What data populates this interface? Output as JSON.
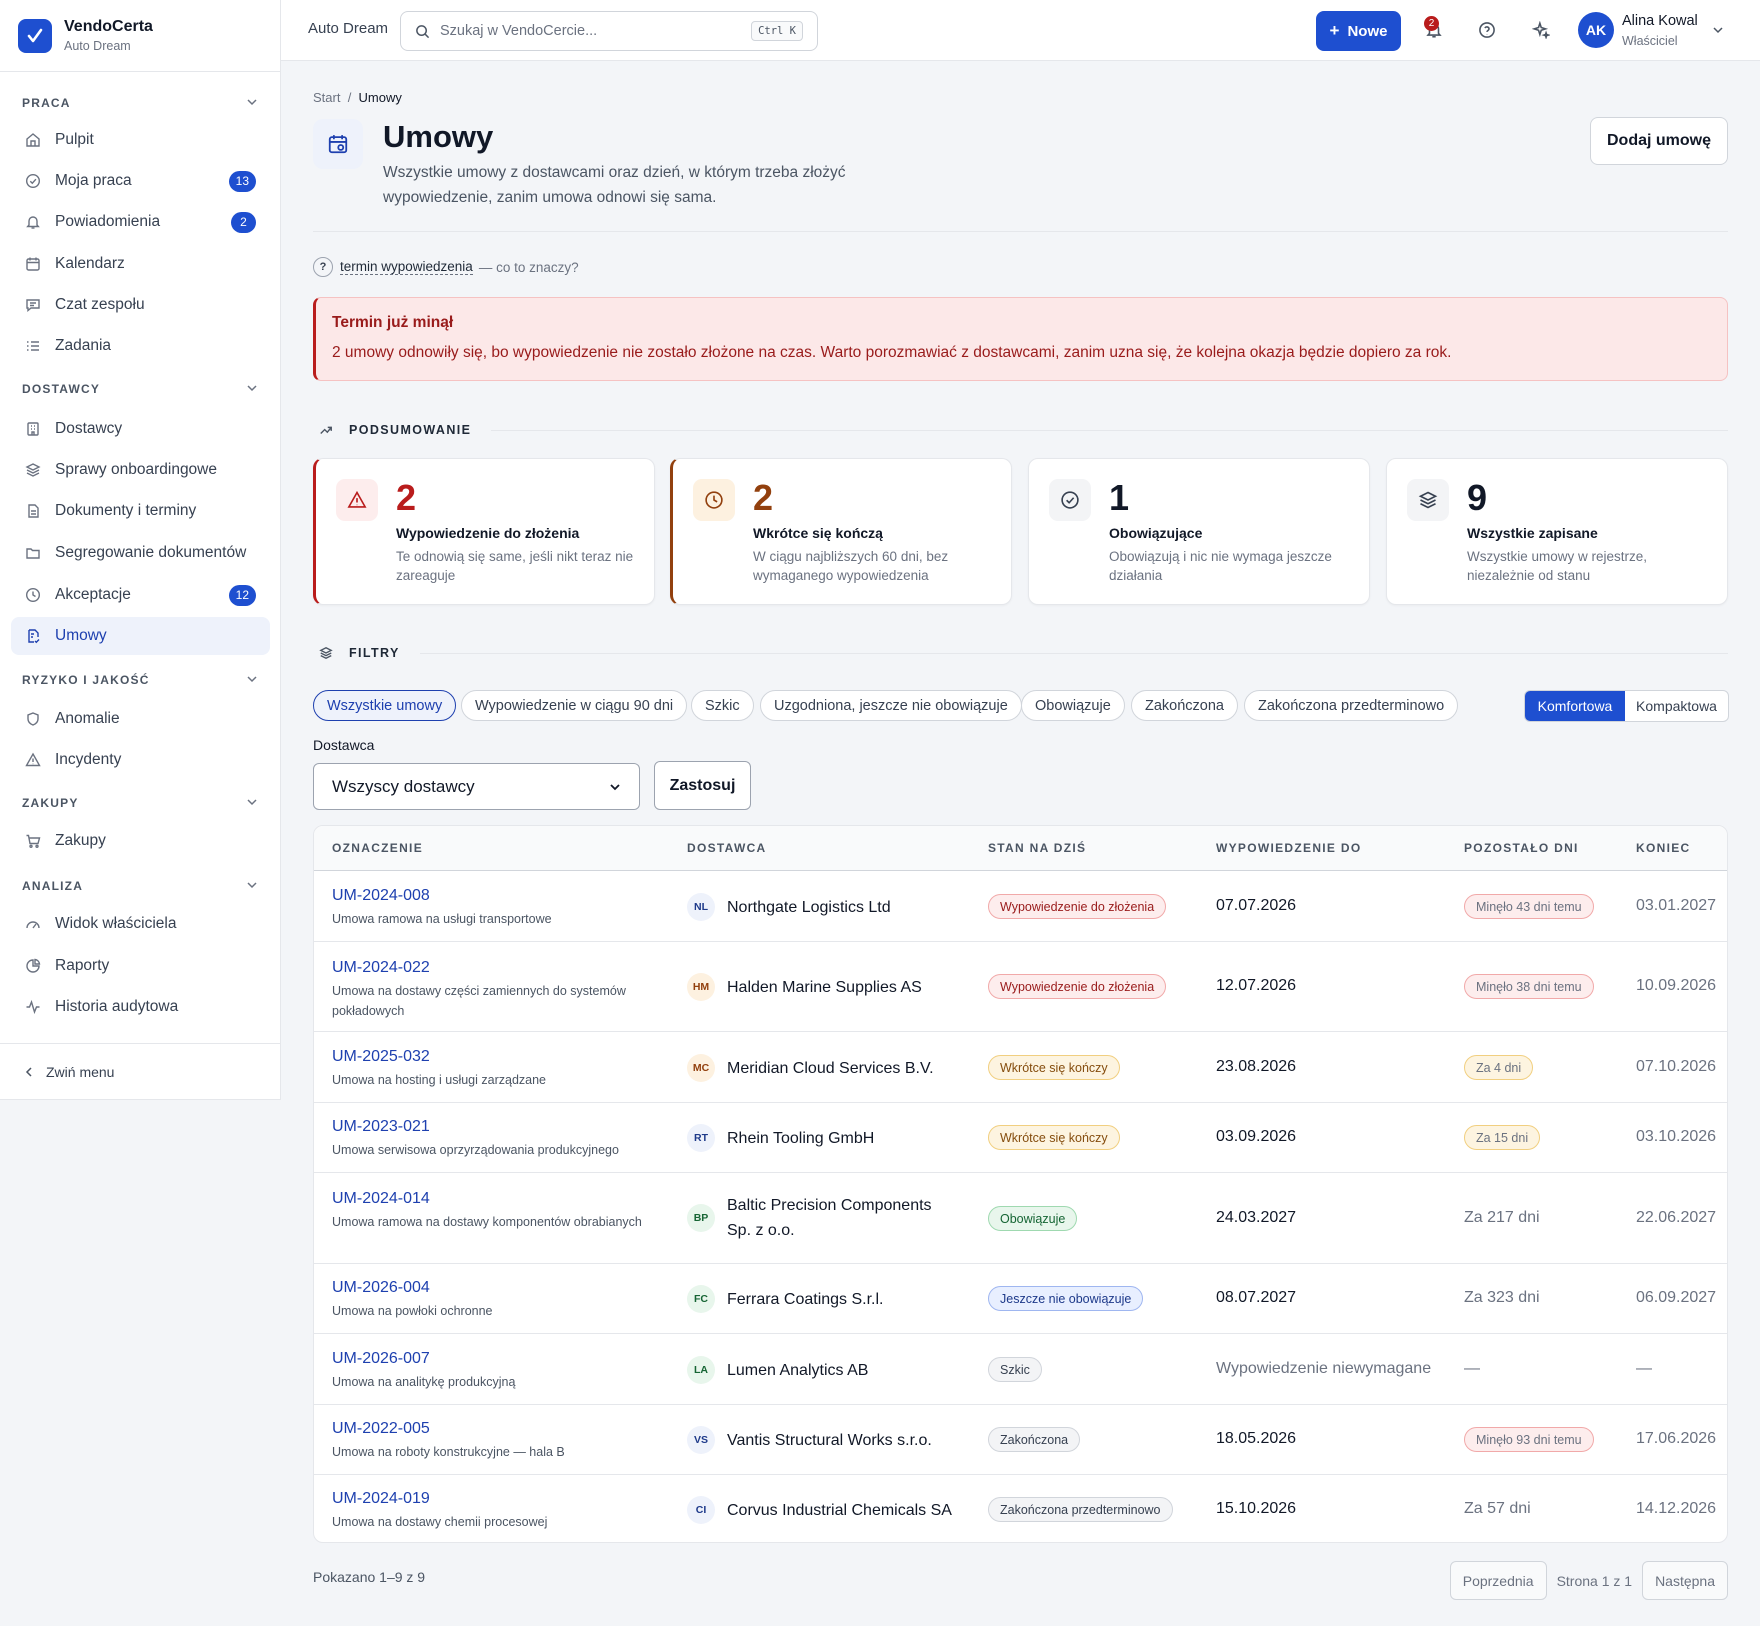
{
  "brand": {
    "name": "VendoCerta",
    "sub": "Auto Dream"
  },
  "sidebar": {
    "sections": [
      {
        "label": "PRACA"
      },
      {
        "label": "DOSTAWCY"
      },
      {
        "label": "RYZYKO I JAKOŚĆ"
      },
      {
        "label": "ZAKUPY"
      },
      {
        "label": "ANALIZA"
      }
    ],
    "items": [
      {
        "label": "Pulpit",
        "icon": "home-icon"
      },
      {
        "label": "Moja praca",
        "icon": "check-circle-icon",
        "badge": "13"
      },
      {
        "label": "Powiadomienia",
        "icon": "bell-icon",
        "badge": "2"
      },
      {
        "label": "Kalendarz",
        "icon": "calendar-icon"
      },
      {
        "label": "Czat zespołu",
        "icon": "chat-icon"
      },
      {
        "label": "Zadania",
        "icon": "list-icon"
      },
      {
        "label": "Dostawcy",
        "icon": "building-icon"
      },
      {
        "label": "Sprawy onboardingowe",
        "icon": "layers-icon"
      },
      {
        "label": "Dokumenty i terminy",
        "icon": "file-icon"
      },
      {
        "label": "Segregowanie dokumentów",
        "icon": "folder-icon"
      },
      {
        "label": "Akceptacje",
        "icon": "clock-icon",
        "badge": "12"
      },
      {
        "label": "Umowy",
        "icon": "contract-icon"
      },
      {
        "label": "Anomalie",
        "icon": "shield-icon"
      },
      {
        "label": "Incydenty",
        "icon": "warning-icon"
      },
      {
        "label": "Zakupy",
        "icon": "cart-icon"
      },
      {
        "label": "Widok właściciela",
        "icon": "gauge-icon"
      },
      {
        "label": "Raporty",
        "icon": "chart-icon"
      },
      {
        "label": "Historia audytowa",
        "icon": "activity-icon"
      }
    ],
    "collapse": "Zwiń menu"
  },
  "topbar": {
    "title": "Auto Dream",
    "search_placeholder": "Szukaj w VendoCercie...",
    "shortcut": "Ctrl K",
    "new_label": "Nowe",
    "notif_count": "2",
    "user": {
      "initials": "AK",
      "name": "Alina Kowal",
      "role": "Właściciel"
    }
  },
  "page": {
    "breadcrumb": {
      "home": "Start",
      "current": "Umowy"
    },
    "title": "Umowy",
    "desc": "Wszystkie umowy z dostawcami oraz dzień, w którym trzeba złożyć wypowiedzenie, zanim umowa odnowi się sama.",
    "add_label": "Dodaj umowę",
    "help": {
      "term": "termin wypowiedzenia",
      "rest": "— co to znaczy?"
    },
    "alert": {
      "title": "Termin już minął",
      "text": "2 umowy odnowiły się, bo wypowiedzenie nie zostało złożone na czas. Warto porozmawiać z dostawcami, zanim uzna się, że kolejna okazja będzie dopiero za rok."
    },
    "summary_title": "PODSUMOWANIE",
    "cards": [
      {
        "num": "2",
        "title": "Wypowiedzenie do złożenia",
        "desc": "Te odnowią się same, jeśli nikt teraz nie zareaguje",
        "color": "#b91c1c",
        "bg": "#fdeded"
      },
      {
        "num": "2",
        "title": "Wkrótce się kończą",
        "desc": "W ciągu najbliższych 60 dni, bez wymaganego wypowiedzenia",
        "color": "#92400e",
        "bg": "#fdf1e0"
      },
      {
        "num": "1",
        "title": "Obowiązujące",
        "desc": "Obowiązują i nic nie wymaga jeszcze działania",
        "color": "#111827",
        "bg": "#f3f4f6"
      },
      {
        "num": "9",
        "title": "Wszystkie zapisane",
        "desc": "Wszystkie umowy w rejestrze, niezależnie od stanu",
        "color": "#111827",
        "bg": "#f3f4f6"
      }
    ],
    "filters_title": "FILTRY",
    "chips": [
      "Wszystkie umowy",
      "Wypowiedzenie w ciągu 90 dni",
      "Szkic",
      "Uzgodniona, jeszcze nie obowiązuje",
      "Obowiązuje",
      "Zakończona",
      "Zakończona przedterminowo"
    ],
    "view": {
      "comfort": "Komfortowa",
      "compact": "Kompaktowa"
    },
    "supplier_label": "Dostawca",
    "supplier_value": "Wszyscy dostawcy",
    "apply_label": "Zastosuj"
  },
  "table": {
    "headers": [
      "OZNACZENIE",
      "DOSTAWCA",
      "STAN NA DZIŚ",
      "WYPOWIEDZENIE DO",
      "POZOSTAŁO DNI",
      "KONIEC"
    ],
    "rows": [
      {
        "id": "UM-2024-008",
        "desc": "Umowa ramowa na usługi transportowe",
        "ini": "NL",
        "supplier": "Northgate Logistics Ltd",
        "status": "Wypowiedzenie do złożenia",
        "notice": "07.07.2026",
        "remaining": "Minęło 43 dni temu",
        "end": "03.01.2027"
      },
      {
        "id": "UM-2024-022",
        "desc": "Umowa na dostawy części zamiennych do systemów pokładowych",
        "ini": "HM",
        "supplier": "Halden Marine Supplies AS",
        "status": "Wypowiedzenie do złożenia",
        "notice": "12.07.2026",
        "remaining": "Minęło 38 dni temu",
        "end": "10.09.2026"
      },
      {
        "id": "UM-2025-032",
        "desc": "Umowa na hosting i usługi zarządzane",
        "ini": "MC",
        "supplier": "Meridian Cloud Services B.V.",
        "status": "Wkrótce się kończy",
        "notice": "23.08.2026",
        "remaining": "Za 4 dni",
        "end": "07.10.2026"
      },
      {
        "id": "UM-2023-021",
        "desc": "Umowa serwisowa oprzyrządowania produkcyjnego",
        "ini": "RT",
        "supplier": "Rhein Tooling GmbH",
        "status": "Wkrótce się kończy",
        "notice": "03.09.2026",
        "remaining": "Za 15 dni",
        "end": "03.10.2026"
      },
      {
        "id": "UM-2024-014",
        "desc": "Umowa ramowa na dostawy komponentów obrabianych",
        "ini": "BP",
        "supplier": "Baltic Precision Components Sp. z o.o.",
        "status": "Obowiązuje",
        "notice": "24.03.2027",
        "remaining": "Za 217 dni",
        "end": "22.06.2027"
      },
      {
        "id": "UM-2026-004",
        "desc": "Umowa na powłoki ochronne",
        "ini": "FC",
        "supplier": "Ferrara Coatings S.r.l.",
        "status": "Jeszcze nie obowiązuje",
        "notice": "08.07.2027",
        "remaining": "Za 323 dni",
        "end": "06.09.2027"
      },
      {
        "id": "UM-2026-007",
        "desc": "Umowa na analitykę produkcyjną",
        "ini": "LA",
        "supplier": "Lumen Analytics AB",
        "status": "Szkic",
        "notice": "Wypowiedzenie niewymagane",
        "remaining": "—",
        "end": "—"
      },
      {
        "id": "UM-2022-005",
        "desc": "Umowa na roboty konstrukcyjne — hala B",
        "ini": "VS",
        "supplier": "Vantis Structural Works s.r.o.",
        "status": "Zakończona",
        "notice": "18.05.2026",
        "remaining": "Minęło 93 dni temu",
        "end": "17.06.2026"
      },
      {
        "id": "UM-2024-019",
        "desc": "Umowa na dostawy chemii procesowej",
        "ini": "CI",
        "supplier": "Corvus Industrial Chemicals SA",
        "status": "Zakończona przedterminowo",
        "notice": "15.10.2026",
        "remaining": "Za 57 dni",
        "end": "14.12.2026"
      }
    ]
  },
  "footer": {
    "info": "Pokazano 1–9 z 9",
    "prev": "Poprzednia",
    "page": "Strona 1 z 1",
    "next": "Następna"
  }
}
